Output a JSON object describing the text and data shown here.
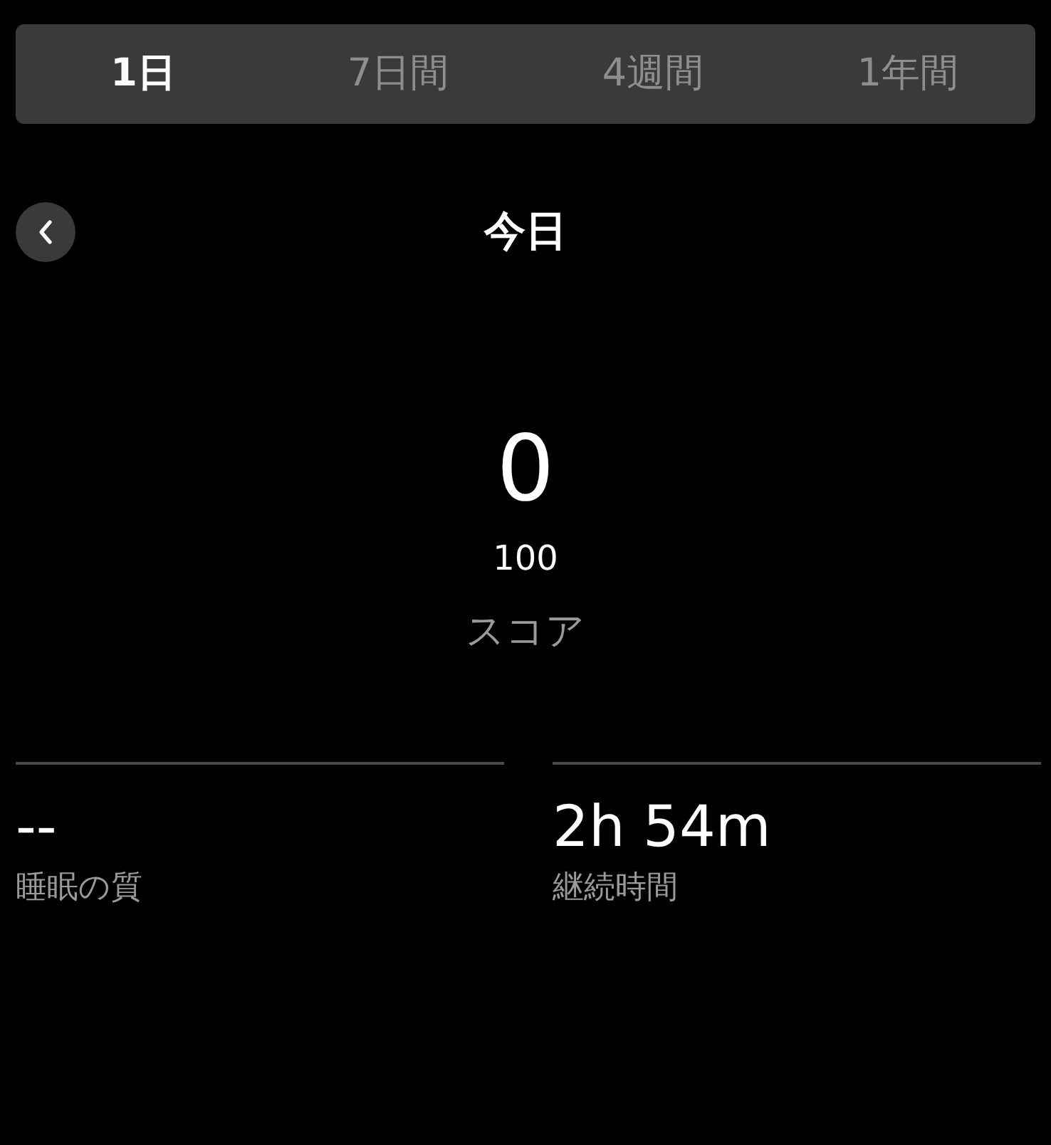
{
  "tabs": [
    {
      "label": "1日",
      "selected": true
    },
    {
      "label": "7日間",
      "selected": false
    },
    {
      "label": "4週間",
      "selected": false
    },
    {
      "label": "1年間",
      "selected": false
    }
  ],
  "header": {
    "title": "今日"
  },
  "score": {
    "value": "0",
    "max": "100",
    "label": "スコア"
  },
  "stats": [
    {
      "value": "--",
      "label": "睡眠の質"
    },
    {
      "value": "2h 54m",
      "label": "継続時間"
    }
  ]
}
